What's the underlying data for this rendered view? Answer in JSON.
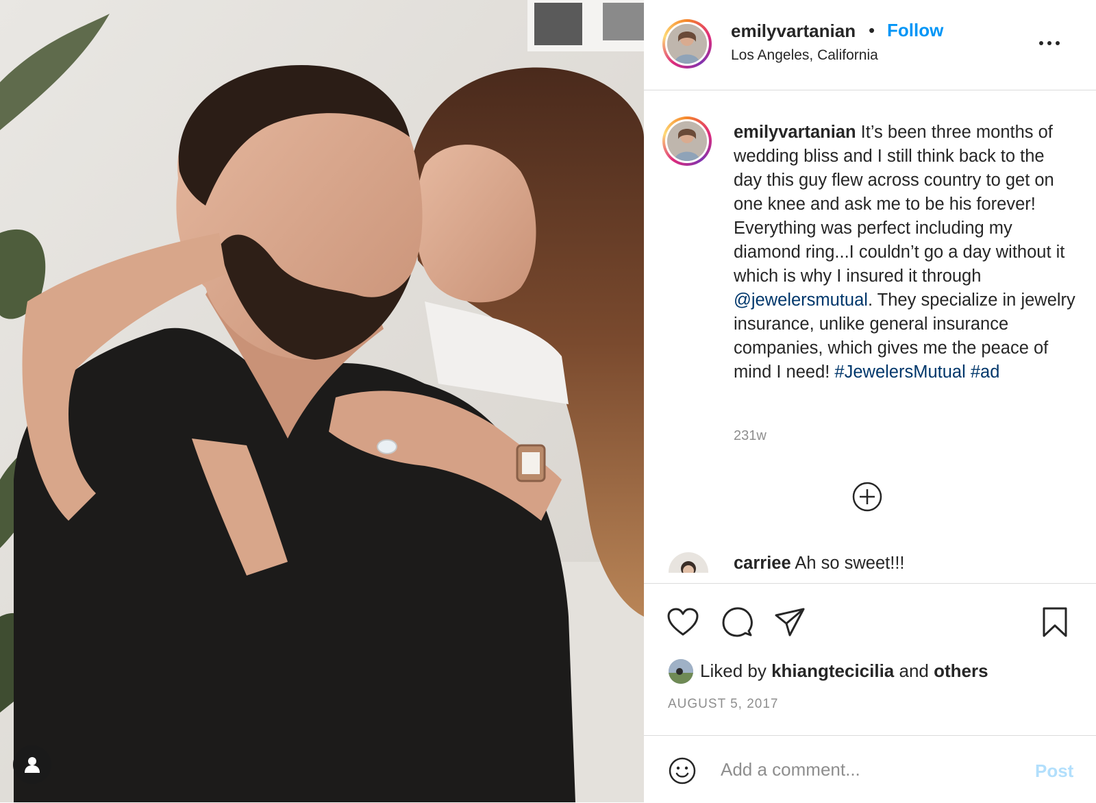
{
  "header": {
    "username": "emilyvartanian",
    "separator": "•",
    "follow_label": "Follow",
    "location": "Los Angeles, California",
    "more_icon": "more-horizontal-icon"
  },
  "caption": {
    "username": "emilyvartanian",
    "text_before_mention": " It’s been three months of wedding bliss and I still think back to the day this guy flew across country to get on one knee and ask me to be his forever! Everything was perfect including my diamond ring...I couldn’t go a day without it which is why I insured it through ",
    "mention": "@jewelersmutual",
    "text_after_mention": ". They specialize in jewelry insurance, unlike general insurance companies, which gives me the peace of mind I need! ",
    "hashtag_1": "#JewelersMutual",
    "space": " ",
    "hashtag_2": "#ad",
    "age": "231w"
  },
  "comment_preview": {
    "username": "carriee",
    "text": " Ah so sweet!!!"
  },
  "actions": {
    "icons": [
      "heart-icon",
      "comment-icon",
      "share-icon",
      "bookmark-icon"
    ],
    "liked_by_prefix": "Liked by ",
    "liked_by_user": "khiangtecicilia",
    "liked_by_and": " and ",
    "liked_by_others": "others",
    "date": "AUGUST 5, 2017"
  },
  "comment_box": {
    "placeholder": "Add a comment...",
    "post_label": "Post"
  },
  "colors": {
    "link_blue": "#0095f6",
    "mention_blue": "#00376b",
    "post_disabled": "#b2dffc",
    "secondary_text": "#8e8e8e",
    "border": "#dbdbdb"
  }
}
